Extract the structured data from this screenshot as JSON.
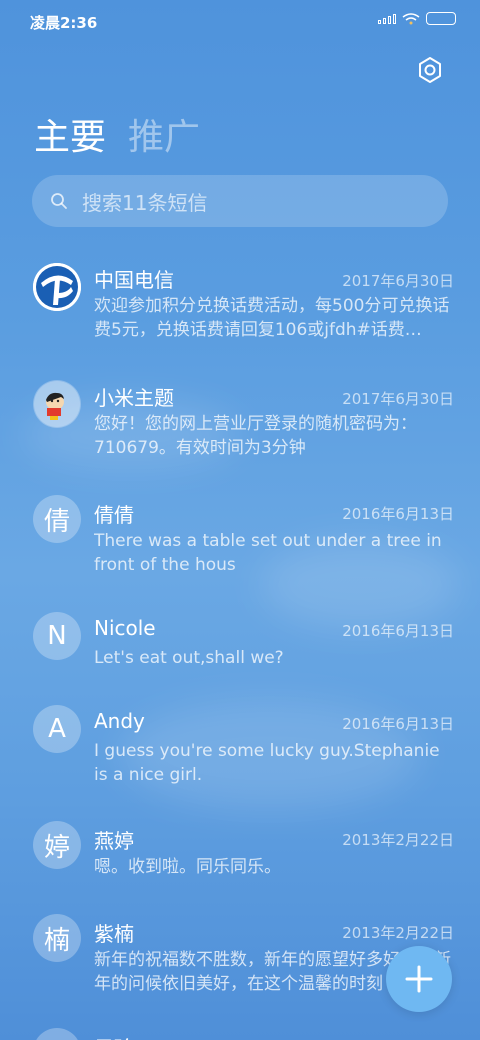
{
  "status_bar": {
    "time": "凌晨2:36"
  },
  "tabs": {
    "primary": "主要",
    "promo": "推广"
  },
  "search": {
    "placeholder": "搜索11条短信"
  },
  "conversations": [
    {
      "avatar_text": "",
      "avatar_icon": "china-telecom-logo",
      "name": "中国电信",
      "date": "2017年6月30日",
      "preview": "欢迎参加积分兑换话费活动，每500分可兑换话费5元，兑换话费请回复106或jfdh#话费…"
    },
    {
      "avatar_text": "",
      "avatar_icon": "cartoon-avatar",
      "name": "小米主题",
      "date": "2017年6月30日",
      "preview": "您好！您的网上营业厅登录的随机密码为：710679。有效时间为3分钟"
    },
    {
      "avatar_text": "倩",
      "name": "倩倩",
      "date": "2016年6月13日",
      "preview": "There was a table set out under a tree in front of the hous"
    },
    {
      "avatar_text": "N",
      "name": "Nicole",
      "date": "2016年6月13日",
      "preview": "Let's eat out,shall we?"
    },
    {
      "avatar_text": "A",
      "name": "Andy",
      "date": "2016年6月13日",
      "preview": "I guess you're some lucky guy.Stephanie is a nice girl."
    },
    {
      "avatar_text": "婷",
      "name": "燕婷",
      "date": "2013年2月22日",
      "preview": "嗯。收到啦。同乐同乐。"
    },
    {
      "avatar_text": "楠",
      "name": "紫楠",
      "date": "2013年2月22日",
      "preview": "新年的祝福数不胜数，新年的愿望好多好多，新年的问候依旧美好，在这个温馨的时刻"
    },
    {
      "avatar_text": "",
      "name": "子玲",
      "date": "",
      "preview": ""
    }
  ],
  "colors": {
    "accent": "#6fb8f2",
    "background": "#5a9de0"
  }
}
